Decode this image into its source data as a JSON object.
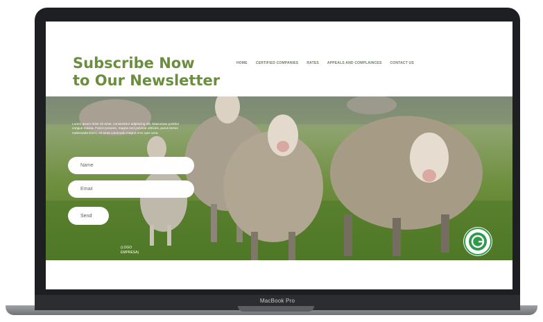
{
  "device": {
    "label": "MacBook Pro"
  },
  "site": {
    "title_line1": "Subscribe Now",
    "title_line2": "to Our Newsletter",
    "nav": [
      "HOME",
      "CERTIFIED COMPANIES",
      "RATES",
      "APPEALS AND COMPLAINCES",
      "CONTACT US"
    ],
    "intro": "Lorem ipsum dolor sit amet, consectetur adipiscing elit. Maecenas porttitor congue massa. Fusce posuere, magna sed pulvinar ultricies, purus lectus malesuada libero, sit amet commodo magna eros quis urna.",
    "form": {
      "name_placeholder": "Name",
      "email_placeholder": "Email",
      "send_label": "Send"
    },
    "logo_placeholder": "(LOGO EMPRESA)",
    "badge_icon": "certification-seal-icon",
    "colors": {
      "title": "#6b8e3e",
      "badge_green": "#2e9a4a"
    }
  }
}
